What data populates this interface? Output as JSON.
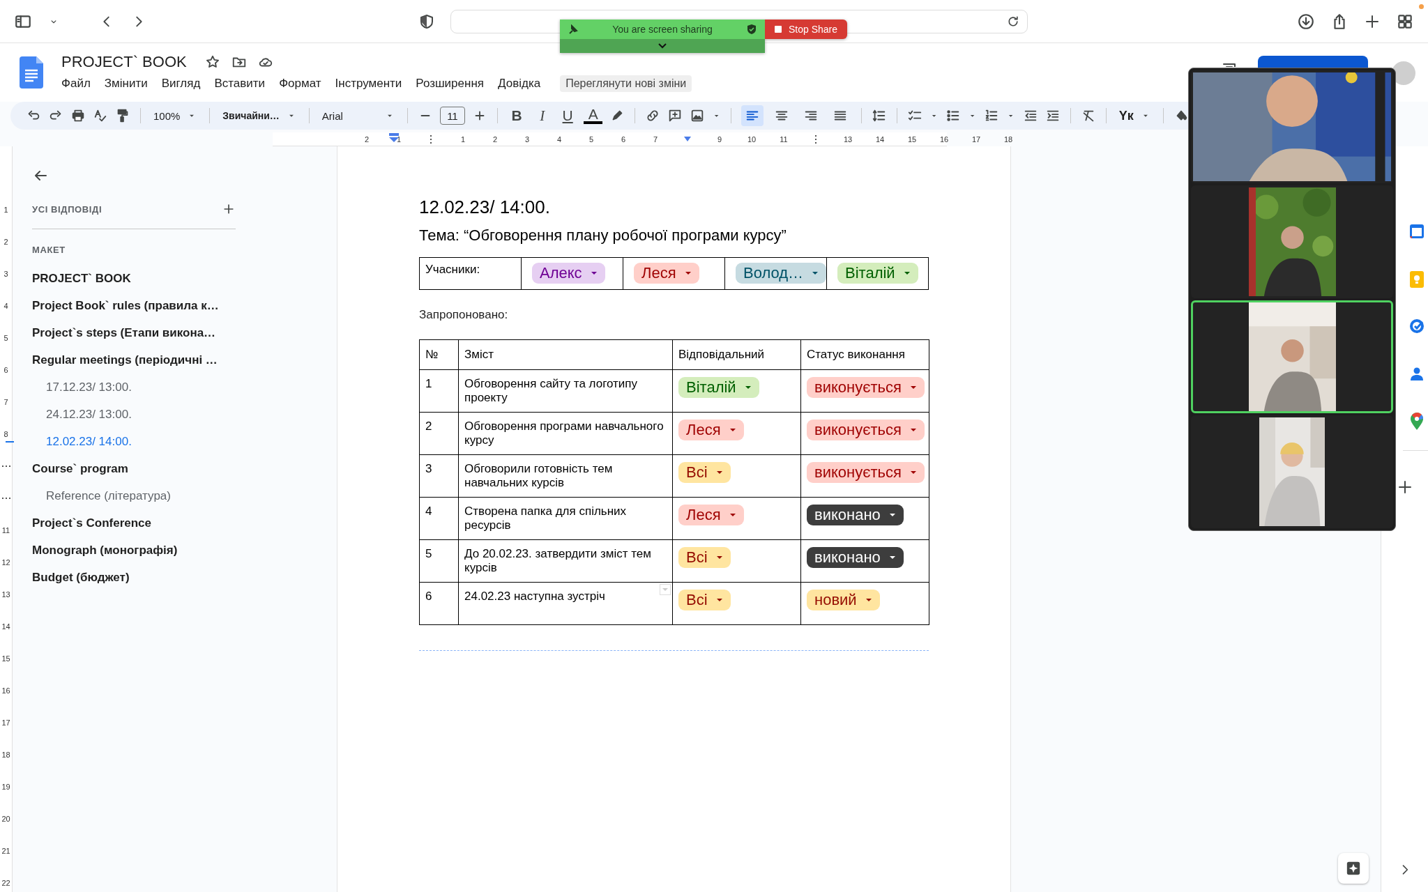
{
  "share_banner": {
    "message": "You are screen sharing",
    "stop_label": "Stop Share"
  },
  "document": {
    "title": "PROJECT` BOOK"
  },
  "menu": [
    "Файл",
    "Змінити",
    "Вигляд",
    "Вставити",
    "Формат",
    "Інструменти",
    "Розширення",
    "Довідка"
  ],
  "review_changes": "Переглянути нові зміни",
  "toolbar": {
    "zoom": "100%",
    "style": "Звичайни…",
    "font": "Arial",
    "font_size": "11",
    "format": [
      "B",
      "I",
      "U",
      "A"
    ],
    "alignment": [
      {
        "kind": "left",
        "selected": true
      },
      {
        "kind": "center",
        "selected": false
      },
      {
        "kind": "right",
        "selected": false
      },
      {
        "kind": "justify",
        "selected": false
      }
    ],
    "input_tools": "Yк"
  },
  "ruler": [
    {
      "kind": "number",
      "label": "2"
    },
    {
      "kind": "number",
      "label": "1"
    },
    {
      "kind": "margin"
    },
    {
      "kind": "number",
      "label": "1"
    },
    {
      "kind": "number",
      "label": "2"
    },
    {
      "kind": "number",
      "label": "3"
    },
    {
      "kind": "number",
      "label": "4"
    },
    {
      "kind": "number",
      "label": "5"
    },
    {
      "kind": "number",
      "label": "6"
    },
    {
      "kind": "number",
      "label": "7"
    },
    {
      "kind": "indent"
    },
    {
      "kind": "number",
      "label": "9"
    },
    {
      "kind": "number",
      "label": "10"
    },
    {
      "kind": "number",
      "label": "11"
    },
    {
      "kind": "margin"
    },
    {
      "kind": "number",
      "label": "13"
    },
    {
      "kind": "number",
      "label": "14"
    },
    {
      "kind": "number",
      "label": "15"
    },
    {
      "kind": "number",
      "label": "16"
    },
    {
      "kind": "number",
      "label": "17"
    },
    {
      "kind": "number",
      "label": "18"
    }
  ],
  "vertical_ruler": [
    {
      "kind": "number",
      "label": "1"
    },
    {
      "kind": "number",
      "label": "2"
    },
    {
      "kind": "number",
      "label": "3"
    },
    {
      "kind": "number",
      "label": "4"
    },
    {
      "kind": "number",
      "label": "5"
    },
    {
      "kind": "number",
      "label": "6"
    },
    {
      "kind": "number",
      "label": "7"
    },
    {
      "kind": "number",
      "label": "8"
    },
    {
      "kind": "margin"
    },
    {
      "kind": "margin"
    },
    {
      "kind": "number",
      "label": "11"
    },
    {
      "kind": "number",
      "label": "12"
    },
    {
      "kind": "number",
      "label": "13"
    },
    {
      "kind": "number",
      "label": "14"
    },
    {
      "kind": "number",
      "label": "15"
    },
    {
      "kind": "number",
      "label": "16"
    },
    {
      "kind": "number",
      "label": "17"
    },
    {
      "kind": "number",
      "label": "18"
    },
    {
      "kind": "number",
      "label": "19"
    },
    {
      "kind": "number",
      "label": "20"
    },
    {
      "kind": "number",
      "label": "21"
    },
    {
      "kind": "number",
      "label": "22"
    }
  ],
  "outline": {
    "label": "УСІ ВІДПОВІДІ",
    "section": "МАКЕТ",
    "items": [
      {
        "title": "PROJECT` BOOK",
        "selected": false
      },
      {
        "title": "Project Book` rules (правила к…",
        "selected": false
      },
      {
        "title": "Project`s steps (Етапи викона…",
        "selected": false
      },
      {
        "title": "Regular meetings (періодичні …",
        "selected": false,
        "children": [
          {
            "title": "17.12.23/ 13:00.",
            "selected": false
          },
          {
            "title": "24.12.23/ 13:00.",
            "selected": false
          },
          {
            "title": "12.02.23/ 14:00.",
            "selected": true
          }
        ]
      },
      {
        "title": "Course` program",
        "selected": false,
        "children": [
          {
            "title": "Reference (література)",
            "selected": false
          }
        ]
      },
      {
        "title": "Project`s Conference",
        "selected": false
      },
      {
        "title": "Monograph (монографія)",
        "selected": false
      },
      {
        "title": "Budget (бюджет)",
        "selected": false
      }
    ]
  },
  "page": {
    "heading": "12.02.23/ 14:00.",
    "topic": "Тема: “Обговорення плану робочої програми курсу”",
    "participants_label": "Учасники:",
    "participants": [
      {
        "name": "Алекс",
        "color": "#e6cff2"
      },
      {
        "name": "Леся",
        "color": "#ffcfc9"
      },
      {
        "name": "Волод…",
        "color": "#c6dbe1"
      },
      {
        "name": "Віталій",
        "color": "#d4edbc"
      }
    ],
    "proposed_label": "Запропоновано:",
    "table": {
      "columns": [
        "№",
        "Зміст",
        "Відповідальний",
        "Статус виконання"
      ],
      "rows": [
        {
          "number": "1",
          "content": "Обговорення сайту та логотипу проекту",
          "responsible": {
            "name": "Віталій",
            "color": "#d4edbc"
          },
          "status": {
            "label": "виконується",
            "color": "#ffcfc9"
          }
        },
        {
          "number": "2",
          "content": "Обговорення програми навчального курсу",
          "responsible": {
            "name": "Леся",
            "color": "#ffcfc9"
          },
          "status": {
            "label": "виконується",
            "color": "#ffcfc9"
          }
        },
        {
          "number": "3",
          "content": "Обговорили готовність тем навчальних курсів",
          "responsible": {
            "name": "Всі",
            "color": "#ffe5a0"
          },
          "status": {
            "label": "виконується",
            "color": "#ffcfc9"
          }
        },
        {
          "number": "4",
          "content": "Створена папка для спільних ресурсів",
          "responsible": {
            "name": "Леся",
            "color": "#ffcfc9"
          },
          "status": {
            "label": "виконано",
            "color": "#3d3d3d"
          }
        },
        {
          "number": "5",
          "content": "До 20.02.23. затвердити зміст тем курсів",
          "responsible": {
            "name": "Всі",
            "color": "#ffe5a0"
          },
          "status": {
            "label": "виконано",
            "color": "#3d3d3d"
          }
        },
        {
          "number": "6",
          "content": "24.02.23 наступна зустріч",
          "responsible": {
            "name": "Всі",
            "color": "#ffe5a0"
          },
          "status": {
            "label": "новий",
            "color": "#ffe5a0"
          }
        }
      ]
    }
  },
  "video_tiles": [
    {
      "kind": "picture",
      "active": false
    },
    {
      "kind": "picture",
      "active": false
    },
    {
      "kind": "picture",
      "active": true
    },
    {
      "kind": "picture",
      "active": false
    }
  ]
}
